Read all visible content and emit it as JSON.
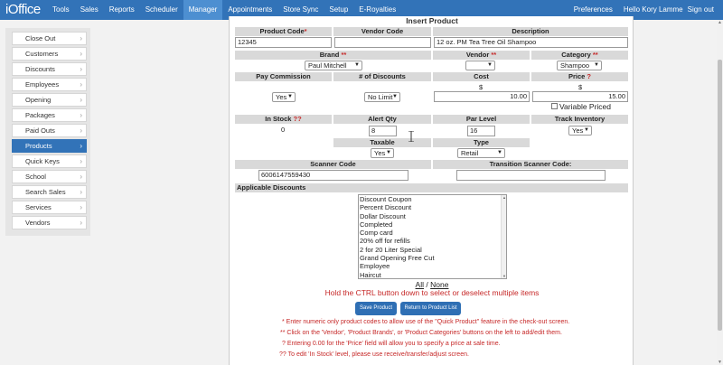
{
  "app": {
    "brand": "iOffice"
  },
  "nav": {
    "items": [
      "Tools",
      "Sales",
      "Reports",
      "Scheduler",
      "Manager",
      "Appointments",
      "Store Sync",
      "Setup",
      "E-Royalties"
    ],
    "active": "Manager",
    "preferences": "Preferences",
    "greeting": "Hello Kory Lamme",
    "sign_out": "Sign out"
  },
  "sidebar": {
    "items": [
      "Close Out",
      "Customers",
      "Discounts",
      "Employees",
      "Opening",
      "Packages",
      "Paid Outs",
      "Products",
      "Quick Keys",
      "School",
      "Search Sales",
      "Services",
      "Vendors"
    ],
    "active": "Products"
  },
  "form": {
    "title": "Insert Product",
    "product_code_label": "Product Code",
    "product_code_marker": "*",
    "product_code": "12345",
    "vendor_code_label": "Vendor Code",
    "vendor_code": "",
    "description_label": "Description",
    "description": "12 oz. PM Tea Tree Oil Shampoo",
    "brand_label": "Brand",
    "brand_marker": "**",
    "brand": "Paul Mitchell",
    "vendor_label": "Vendor",
    "vendor_marker": "**",
    "vendor": "",
    "category_label": "Category",
    "category_marker": "**",
    "category": "Shampoo",
    "pay_commission_label": "Pay Commission",
    "pay_commission": "Yes",
    "num_discounts_label": "# of Discounts",
    "num_discounts": "No Limit",
    "cost_label": "Cost",
    "cost_currency": "$",
    "cost": "10.00",
    "price_label": "Price",
    "price_marker": "?",
    "price_currency": "$",
    "price": "15.00",
    "variable_priced_label": "Variable Priced",
    "in_stock_label": "In Stock",
    "in_stock_marker": "??",
    "in_stock": "0",
    "alert_qty_label": "Alert Qty",
    "alert_qty": "8",
    "par_level_label": "Par Level",
    "par_level": "16",
    "track_inventory_label": "Track Inventory",
    "track_inventory": "Yes",
    "taxable_label": "Taxable",
    "taxable": "Yes",
    "type_label": "Type",
    "type": "Retail",
    "scanner_code_label": "Scanner Code",
    "scanner_code": "6006147559430",
    "transition_scanner_label": "Transition Scanner Code:",
    "transition_scanner_code": "",
    "applicable_discounts_label": "Applicable Discounts",
    "discounts": [
      "Discount Coupon",
      "Percent Discount",
      "Dollar Discount",
      "Completed",
      "Comp card",
      "20% off for refills",
      "2 for 20 Liter Special",
      "Grand Opening Free Cut",
      "Employee",
      "Haircut"
    ],
    "all_link": "All",
    "separator": "/",
    "none_link": "None",
    "ctrl_hint": "Hold the CTRL button down to select or deselect multiple items",
    "save_button": "Save Product",
    "return_button": "Return to Product List"
  },
  "notes": [
    "*  Enter numeric only product codes to allow use of the \"Quick Product\" feature in the check-out screen.",
    "**  Click on the 'Vendor', 'Product Brands', or 'Product Categories' buttons on the left to add/edit them.",
    "?  Entering 0.00 for the 'Price' field will allow you to specify a price at sale time.",
    "??  To edit 'In Stock' level, please use receive/transfer/adjust screen."
  ],
  "colors": {
    "topbar": "#3273b8",
    "active": "#4d8fd1",
    "required": "#c62828",
    "button": "#2f6fb4"
  }
}
